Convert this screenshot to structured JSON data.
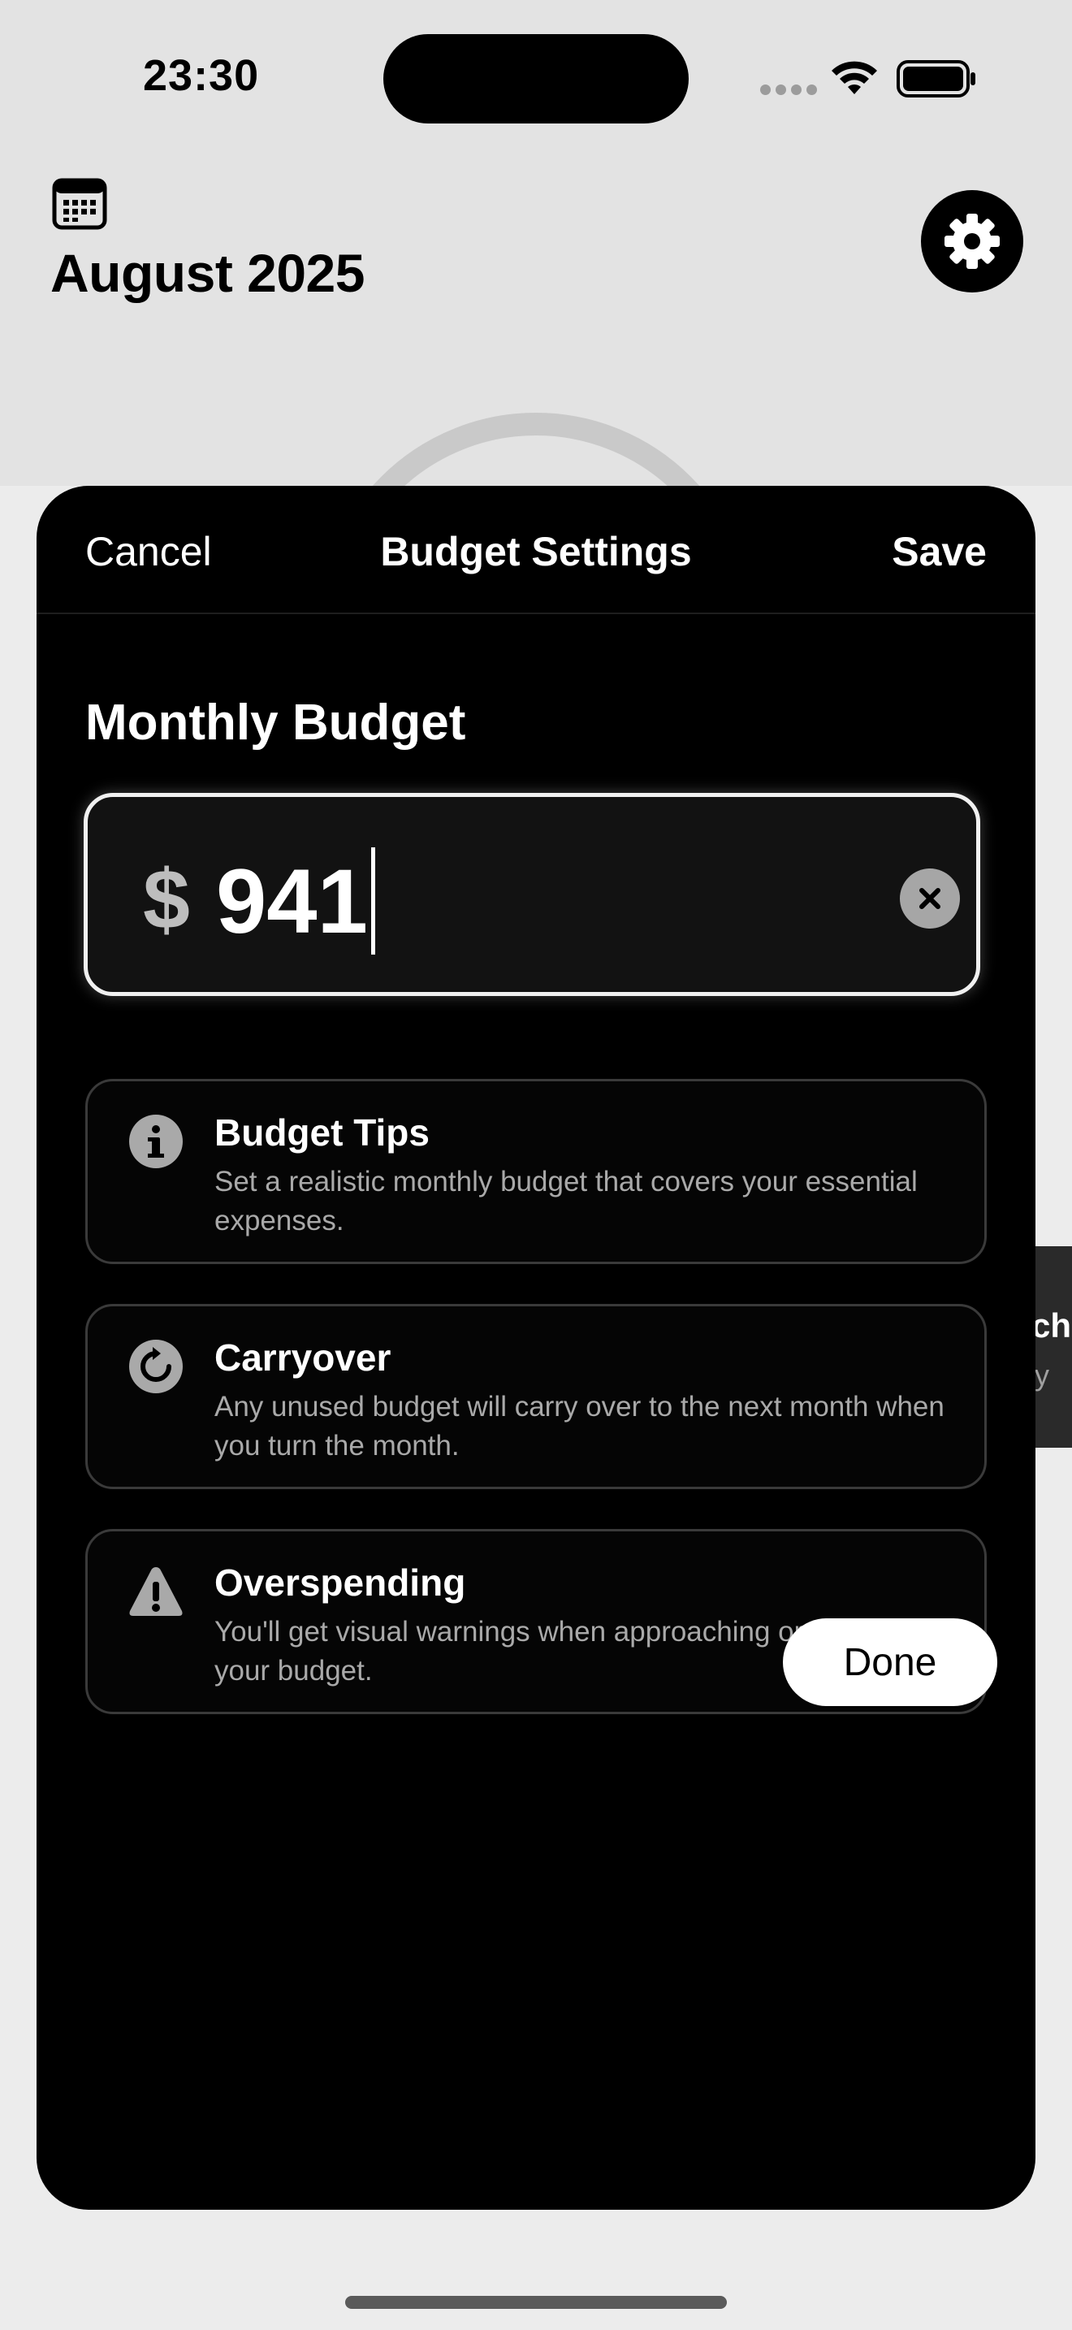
{
  "status_bar": {
    "time": "23:30"
  },
  "background": {
    "month_title": "August 2025",
    "side_card_title": "ch",
    "side_card_sub": "y"
  },
  "sheet": {
    "nav": {
      "cancel_label": "Cancel",
      "title": "Budget Settings",
      "save_label": "Save"
    },
    "section_title": "Monthly Budget",
    "budget_input": {
      "currency_symbol": "$",
      "value": "941"
    },
    "cards": [
      {
        "icon": "info-icon",
        "title": "Budget Tips",
        "description": "Set a realistic monthly budget that covers your essential expenses."
      },
      {
        "icon": "refresh-icon",
        "title": "Carryover",
        "description": "Any unused budget will carry over to the next month when you turn the month."
      },
      {
        "icon": "warning-icon",
        "title": "Overspending",
        "description": "You'll get visual warnings when approaching or exceeding your budget."
      }
    ],
    "done_label": "Done"
  }
}
